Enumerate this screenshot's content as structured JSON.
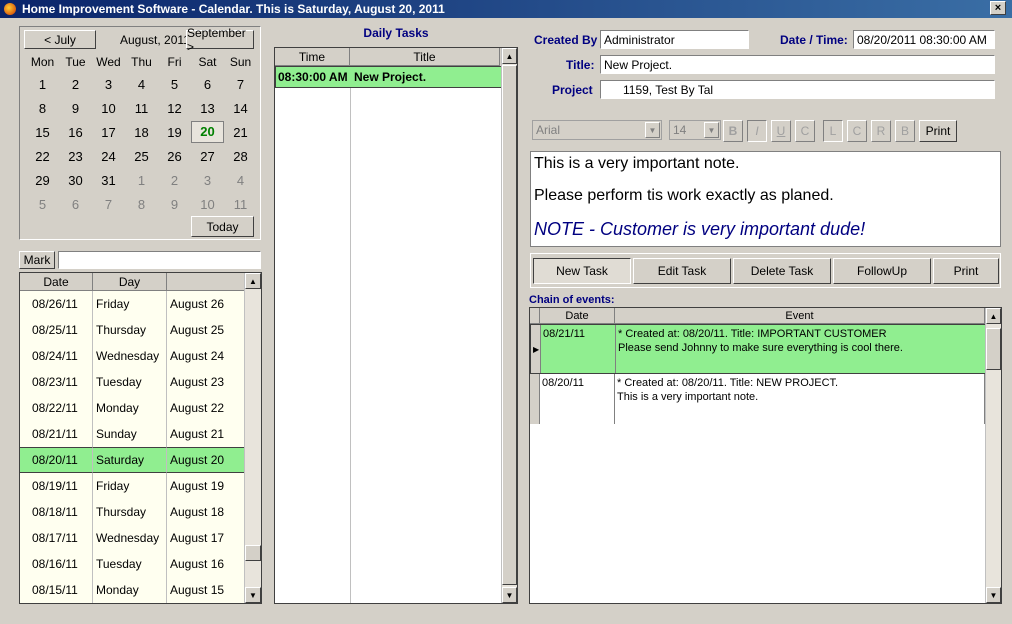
{
  "window": {
    "title": "Home Improvement Software - Calendar.  This is Saturday, August 20, 2011",
    "close": "×"
  },
  "calendar": {
    "prev_label": "< July",
    "month_label": "August, 2011",
    "next_label": "September >",
    "today_label": "Today",
    "weekdays": [
      "Mon",
      "Tue",
      "Wed",
      "Thu",
      "Fri",
      "Sat",
      "Sun"
    ],
    "weeks": [
      [
        "1",
        "2",
        "3",
        "4",
        "5",
        "6",
        "7"
      ],
      [
        "8",
        "9",
        "10",
        "11",
        "12",
        "13",
        "14"
      ],
      [
        "15",
        "16",
        "17",
        "18",
        "19",
        "20",
        "21"
      ],
      [
        "22",
        "23",
        "24",
        "25",
        "26",
        "27",
        "28"
      ],
      [
        "29",
        "30",
        "31",
        "1",
        "2",
        "3",
        "4"
      ],
      [
        "5",
        "6",
        "7",
        "8",
        "9",
        "10",
        "11"
      ]
    ]
  },
  "mark": {
    "label": "Mark",
    "value": ""
  },
  "date_list": {
    "headers": [
      "Date",
      "Day",
      ""
    ],
    "rows": [
      [
        "08/26/11",
        "Friday",
        "August 26"
      ],
      [
        "08/25/11",
        "Thursday",
        "August 25"
      ],
      [
        "08/24/11",
        "Wednesday",
        "August 24"
      ],
      [
        "08/23/11",
        "Tuesday",
        "August 23"
      ],
      [
        "08/22/11",
        "Monday",
        "August 22"
      ],
      [
        "08/21/11",
        "Sunday",
        "August 21"
      ],
      [
        "08/20/11",
        "Saturday",
        "August 20"
      ],
      [
        "08/19/11",
        "Friday",
        "August 19"
      ],
      [
        "08/18/11",
        "Thursday",
        "August 18"
      ],
      [
        "08/17/11",
        "Wednesday",
        "August 17"
      ],
      [
        "08/16/11",
        "Tuesday",
        "August 16"
      ],
      [
        "08/15/11",
        "Monday",
        "August 15"
      ]
    ]
  },
  "daily": {
    "title": "Daily Tasks",
    "headers": [
      "Time",
      "Title"
    ],
    "rows": [
      [
        "08:30:00 AM",
        "New Project."
      ]
    ]
  },
  "task": {
    "created_by_label": "Created By",
    "created_by": "Administrator",
    "datetime_label": "Date / Time:",
    "datetime": "08/20/2011 08:30:00 AM",
    "title_label": "Title:",
    "title": "New Project.",
    "project_label": "Project",
    "project": "1159, Test By Tal"
  },
  "format": {
    "font": "Arial",
    "size": "14",
    "bold": "B",
    "italic": "I",
    "underline": "U",
    "color": "C",
    "left": "L",
    "center": "C",
    "right": "R",
    "bullet": "B",
    "print": "Print"
  },
  "note": {
    "line1": "This is a very important note.",
    "line2": "Please perform tis work exactly as planed.",
    "line3": "NOTE - Customer is very important dude!"
  },
  "actions": {
    "new": "New Task",
    "edit": "Edit Task",
    "delete": "Delete Task",
    "followup": "FollowUp",
    "print": "Print"
  },
  "chain": {
    "label": "Chain of events:",
    "headers": [
      "Date",
      "Event"
    ],
    "rows": [
      {
        "date": "08/21/11",
        "line1": "* Created at: 08/20/11.  Title: IMPORTANT CUSTOMER",
        "line2": "Please send Johnny to make sure everything is cool there."
      },
      {
        "date": "08/20/11",
        "line1": "* Created at: 08/20/11.  Title: NEW PROJECT.",
        "line2": "This is a very important note."
      }
    ]
  }
}
